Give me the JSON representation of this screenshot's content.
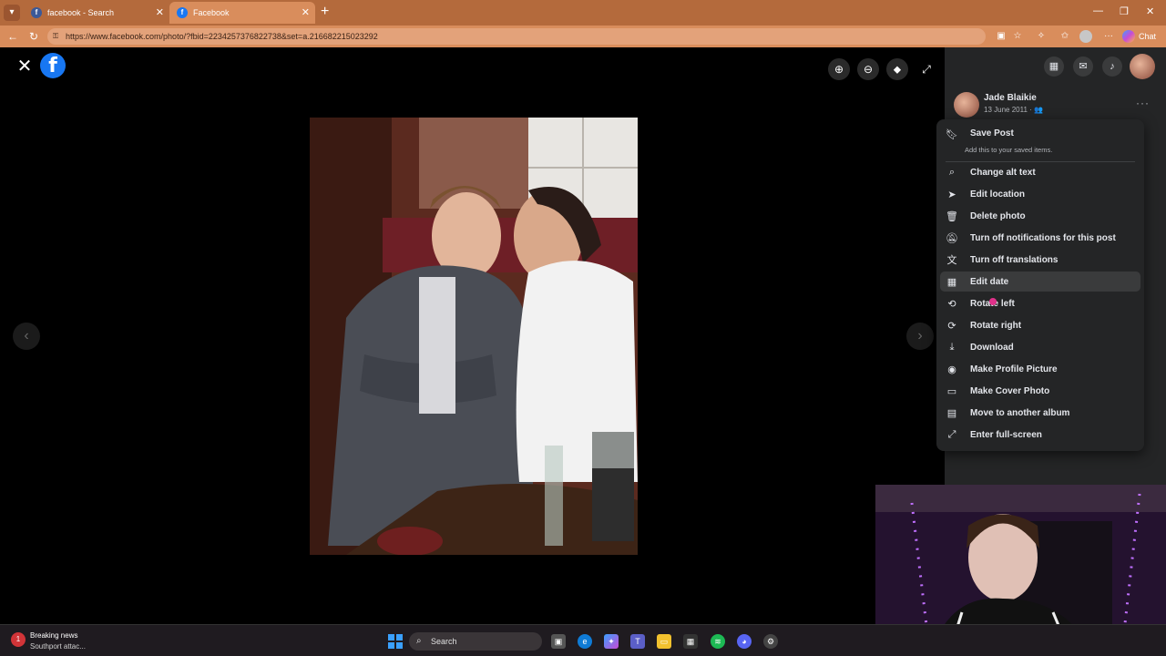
{
  "browser": {
    "tabs": [
      {
        "title": "facebook - Search",
        "active": false
      },
      {
        "title": "Facebook",
        "active": true
      }
    ],
    "url": "https://www.facebook.com/photo/?fbid=2234257376822738&set=a.216682215023292",
    "chat_label": "Chat"
  },
  "post": {
    "author": "Jade Blaikie",
    "date": "13 June 2011 ·"
  },
  "menu": {
    "items": [
      {
        "label": "Save Post",
        "icon": "bookmark-icon",
        "sub": "Add this to your saved items."
      },
      {
        "label": "Change alt text",
        "icon": "search-icon"
      },
      {
        "label": "Edit location",
        "icon": "location-arrow-icon"
      },
      {
        "label": "Delete photo",
        "icon": "trash-icon"
      },
      {
        "label": "Turn off notifications for this post",
        "icon": "bell-off-icon"
      },
      {
        "label": "Turn off translations",
        "icon": "translate-icon"
      },
      {
        "label": "Edit date",
        "icon": "calendar-icon",
        "highlighted": true
      },
      {
        "label": "Rotate left",
        "icon": "rotate-left-icon"
      },
      {
        "label": "Rotate right",
        "icon": "rotate-right-icon"
      },
      {
        "label": "Download",
        "icon": "download-icon"
      },
      {
        "label": "Make Profile Picture",
        "icon": "profile-icon"
      },
      {
        "label": "Make Cover Photo",
        "icon": "image-icon"
      },
      {
        "label": "Move to another album",
        "icon": "album-icon"
      },
      {
        "label": "Enter full-screen",
        "icon": "fullscreen-icon"
      }
    ]
  },
  "taskbar": {
    "news_title": "Breaking news",
    "news_sub": "Southport attac...",
    "news_badge": "1",
    "search_placeholder": "Search"
  },
  "colors": {
    "tab_bar": "#b46a3c",
    "address_bar": "#d98d5c",
    "facebook_blue": "#1877f2",
    "panel_bg": "#242526",
    "menu_hover": "#3a3b3c"
  }
}
